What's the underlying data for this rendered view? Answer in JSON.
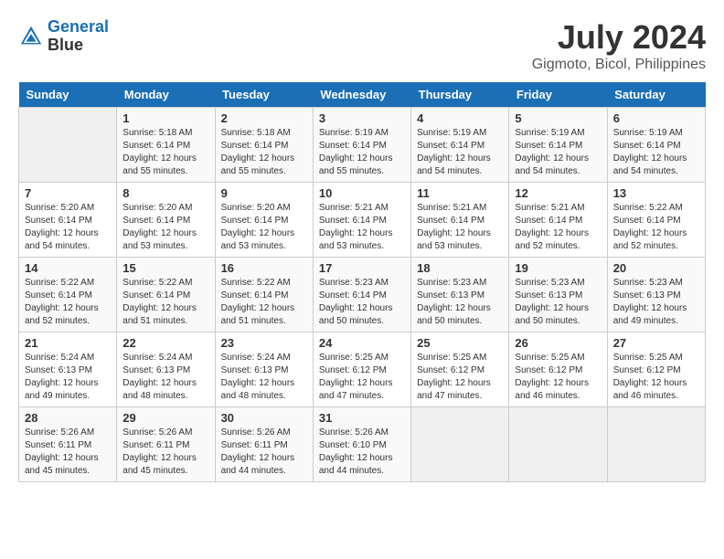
{
  "header": {
    "logo_line1": "General",
    "logo_line2": "Blue",
    "month_year": "July 2024",
    "location": "Gigmoto, Bicol, Philippines"
  },
  "days_of_week": [
    "Sunday",
    "Monday",
    "Tuesday",
    "Wednesday",
    "Thursday",
    "Friday",
    "Saturday"
  ],
  "weeks": [
    [
      {
        "day": "",
        "info": ""
      },
      {
        "day": "1",
        "info": "Sunrise: 5:18 AM\nSunset: 6:14 PM\nDaylight: 12 hours\nand 55 minutes."
      },
      {
        "day": "2",
        "info": "Sunrise: 5:18 AM\nSunset: 6:14 PM\nDaylight: 12 hours\nand 55 minutes."
      },
      {
        "day": "3",
        "info": "Sunrise: 5:19 AM\nSunset: 6:14 PM\nDaylight: 12 hours\nand 55 minutes."
      },
      {
        "day": "4",
        "info": "Sunrise: 5:19 AM\nSunset: 6:14 PM\nDaylight: 12 hours\nand 54 minutes."
      },
      {
        "day": "5",
        "info": "Sunrise: 5:19 AM\nSunset: 6:14 PM\nDaylight: 12 hours\nand 54 minutes."
      },
      {
        "day": "6",
        "info": "Sunrise: 5:19 AM\nSunset: 6:14 PM\nDaylight: 12 hours\nand 54 minutes."
      }
    ],
    [
      {
        "day": "7",
        "info": "Sunrise: 5:20 AM\nSunset: 6:14 PM\nDaylight: 12 hours\nand 54 minutes."
      },
      {
        "day": "8",
        "info": "Sunrise: 5:20 AM\nSunset: 6:14 PM\nDaylight: 12 hours\nand 53 minutes."
      },
      {
        "day": "9",
        "info": "Sunrise: 5:20 AM\nSunset: 6:14 PM\nDaylight: 12 hours\nand 53 minutes."
      },
      {
        "day": "10",
        "info": "Sunrise: 5:21 AM\nSunset: 6:14 PM\nDaylight: 12 hours\nand 53 minutes."
      },
      {
        "day": "11",
        "info": "Sunrise: 5:21 AM\nSunset: 6:14 PM\nDaylight: 12 hours\nand 53 minutes."
      },
      {
        "day": "12",
        "info": "Sunrise: 5:21 AM\nSunset: 6:14 PM\nDaylight: 12 hours\nand 52 minutes."
      },
      {
        "day": "13",
        "info": "Sunrise: 5:22 AM\nSunset: 6:14 PM\nDaylight: 12 hours\nand 52 minutes."
      }
    ],
    [
      {
        "day": "14",
        "info": "Sunrise: 5:22 AM\nSunset: 6:14 PM\nDaylight: 12 hours\nand 52 minutes."
      },
      {
        "day": "15",
        "info": "Sunrise: 5:22 AM\nSunset: 6:14 PM\nDaylight: 12 hours\nand 51 minutes."
      },
      {
        "day": "16",
        "info": "Sunrise: 5:22 AM\nSunset: 6:14 PM\nDaylight: 12 hours\nand 51 minutes."
      },
      {
        "day": "17",
        "info": "Sunrise: 5:23 AM\nSunset: 6:14 PM\nDaylight: 12 hours\nand 50 minutes."
      },
      {
        "day": "18",
        "info": "Sunrise: 5:23 AM\nSunset: 6:13 PM\nDaylight: 12 hours\nand 50 minutes."
      },
      {
        "day": "19",
        "info": "Sunrise: 5:23 AM\nSunset: 6:13 PM\nDaylight: 12 hours\nand 50 minutes."
      },
      {
        "day": "20",
        "info": "Sunrise: 5:23 AM\nSunset: 6:13 PM\nDaylight: 12 hours\nand 49 minutes."
      }
    ],
    [
      {
        "day": "21",
        "info": "Sunrise: 5:24 AM\nSunset: 6:13 PM\nDaylight: 12 hours\nand 49 minutes."
      },
      {
        "day": "22",
        "info": "Sunrise: 5:24 AM\nSunset: 6:13 PM\nDaylight: 12 hours\nand 48 minutes."
      },
      {
        "day": "23",
        "info": "Sunrise: 5:24 AM\nSunset: 6:13 PM\nDaylight: 12 hours\nand 48 minutes."
      },
      {
        "day": "24",
        "info": "Sunrise: 5:25 AM\nSunset: 6:12 PM\nDaylight: 12 hours\nand 47 minutes."
      },
      {
        "day": "25",
        "info": "Sunrise: 5:25 AM\nSunset: 6:12 PM\nDaylight: 12 hours\nand 47 minutes."
      },
      {
        "day": "26",
        "info": "Sunrise: 5:25 AM\nSunset: 6:12 PM\nDaylight: 12 hours\nand 46 minutes."
      },
      {
        "day": "27",
        "info": "Sunrise: 5:25 AM\nSunset: 6:12 PM\nDaylight: 12 hours\nand 46 minutes."
      }
    ],
    [
      {
        "day": "28",
        "info": "Sunrise: 5:26 AM\nSunset: 6:11 PM\nDaylight: 12 hours\nand 45 minutes."
      },
      {
        "day": "29",
        "info": "Sunrise: 5:26 AM\nSunset: 6:11 PM\nDaylight: 12 hours\nand 45 minutes."
      },
      {
        "day": "30",
        "info": "Sunrise: 5:26 AM\nSunset: 6:11 PM\nDaylight: 12 hours\nand 44 minutes."
      },
      {
        "day": "31",
        "info": "Sunrise: 5:26 AM\nSunset: 6:10 PM\nDaylight: 12 hours\nand 44 minutes."
      },
      {
        "day": "",
        "info": ""
      },
      {
        "day": "",
        "info": ""
      },
      {
        "day": "",
        "info": ""
      }
    ]
  ]
}
